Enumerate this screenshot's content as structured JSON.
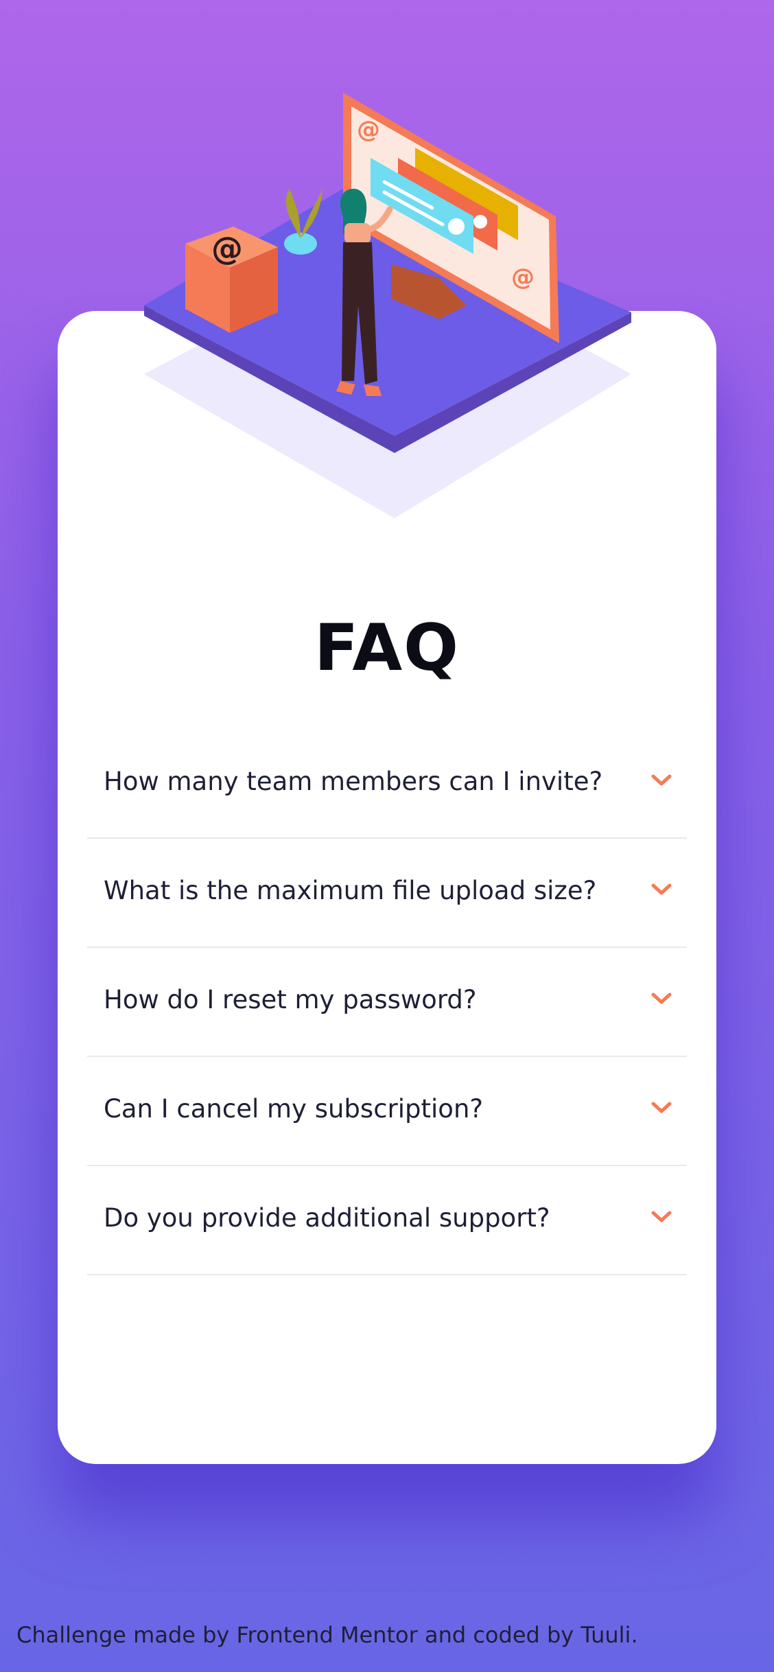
{
  "faq": {
    "title": "FAQ",
    "items": [
      {
        "question": "How many team members can I invite?",
        "icon": "chevron-down-icon"
      },
      {
        "question": "What is the maximum file upload size?",
        "icon": "chevron-down-icon"
      },
      {
        "question": "How do I reset my password?",
        "icon": "chevron-down-icon"
      },
      {
        "question": "Can I cancel my subscription?",
        "icon": "chevron-down-icon"
      },
      {
        "question": "Do you provide additional support?",
        "icon": "chevron-down-icon"
      }
    ]
  },
  "footer": {
    "attribution": "Challenge made by Frontend Mentor and coded by Tuuli."
  },
  "colors": {
    "accent": "#f47b56",
    "text_dark": "#1e1f36",
    "card": "#ffffff",
    "bg_top": "#ae66ea",
    "bg_bottom": "#6866e6"
  },
  "illustration": {
    "icon": "woman-online-illustration"
  }
}
